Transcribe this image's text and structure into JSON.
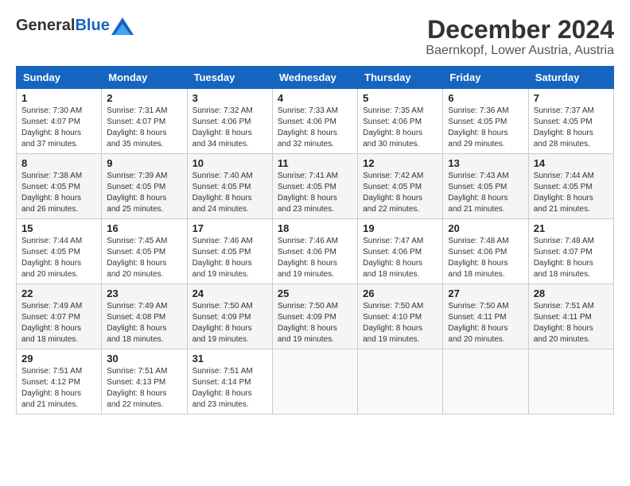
{
  "header": {
    "logo_general": "General",
    "logo_blue": "Blue",
    "title": "December 2024",
    "subtitle": "Baernkopf, Lower Austria, Austria"
  },
  "calendar": {
    "days_of_week": [
      "Sunday",
      "Monday",
      "Tuesday",
      "Wednesday",
      "Thursday",
      "Friday",
      "Saturday"
    ],
    "weeks": [
      [
        {
          "day": "",
          "info": ""
        },
        {
          "day": "2",
          "info": "Sunrise: 7:31 AM\nSunset: 4:07 PM\nDaylight: 8 hours\nand 35 minutes."
        },
        {
          "day": "3",
          "info": "Sunrise: 7:32 AM\nSunset: 4:06 PM\nDaylight: 8 hours\nand 34 minutes."
        },
        {
          "day": "4",
          "info": "Sunrise: 7:33 AM\nSunset: 4:06 PM\nDaylight: 8 hours\nand 32 minutes."
        },
        {
          "day": "5",
          "info": "Sunrise: 7:35 AM\nSunset: 4:06 PM\nDaylight: 8 hours\nand 30 minutes."
        },
        {
          "day": "6",
          "info": "Sunrise: 7:36 AM\nSunset: 4:05 PM\nDaylight: 8 hours\nand 29 minutes."
        },
        {
          "day": "7",
          "info": "Sunrise: 7:37 AM\nSunset: 4:05 PM\nDaylight: 8 hours\nand 28 minutes."
        }
      ],
      [
        {
          "day": "8",
          "info": "Sunrise: 7:38 AM\nSunset: 4:05 PM\nDaylight: 8 hours\nand 26 minutes."
        },
        {
          "day": "9",
          "info": "Sunrise: 7:39 AM\nSunset: 4:05 PM\nDaylight: 8 hours\nand 25 minutes."
        },
        {
          "day": "10",
          "info": "Sunrise: 7:40 AM\nSunset: 4:05 PM\nDaylight: 8 hours\nand 24 minutes."
        },
        {
          "day": "11",
          "info": "Sunrise: 7:41 AM\nSunset: 4:05 PM\nDaylight: 8 hours\nand 23 minutes."
        },
        {
          "day": "12",
          "info": "Sunrise: 7:42 AM\nSunset: 4:05 PM\nDaylight: 8 hours\nand 22 minutes."
        },
        {
          "day": "13",
          "info": "Sunrise: 7:43 AM\nSunset: 4:05 PM\nDaylight: 8 hours\nand 21 minutes."
        },
        {
          "day": "14",
          "info": "Sunrise: 7:44 AM\nSunset: 4:05 PM\nDaylight: 8 hours\nand 21 minutes."
        }
      ],
      [
        {
          "day": "15",
          "info": "Sunrise: 7:44 AM\nSunset: 4:05 PM\nDaylight: 8 hours\nand 20 minutes."
        },
        {
          "day": "16",
          "info": "Sunrise: 7:45 AM\nSunset: 4:05 PM\nDaylight: 8 hours\nand 20 minutes."
        },
        {
          "day": "17",
          "info": "Sunrise: 7:46 AM\nSunset: 4:05 PM\nDaylight: 8 hours\nand 19 minutes."
        },
        {
          "day": "18",
          "info": "Sunrise: 7:46 AM\nSunset: 4:06 PM\nDaylight: 8 hours\nand 19 minutes."
        },
        {
          "day": "19",
          "info": "Sunrise: 7:47 AM\nSunset: 4:06 PM\nDaylight: 8 hours\nand 18 minutes."
        },
        {
          "day": "20",
          "info": "Sunrise: 7:48 AM\nSunset: 4:06 PM\nDaylight: 8 hours\nand 18 minutes."
        },
        {
          "day": "21",
          "info": "Sunrise: 7:48 AM\nSunset: 4:07 PM\nDaylight: 8 hours\nand 18 minutes."
        }
      ],
      [
        {
          "day": "22",
          "info": "Sunrise: 7:49 AM\nSunset: 4:07 PM\nDaylight: 8 hours\nand 18 minutes."
        },
        {
          "day": "23",
          "info": "Sunrise: 7:49 AM\nSunset: 4:08 PM\nDaylight: 8 hours\nand 18 minutes."
        },
        {
          "day": "24",
          "info": "Sunrise: 7:50 AM\nSunset: 4:09 PM\nDaylight: 8 hours\nand 19 minutes."
        },
        {
          "day": "25",
          "info": "Sunrise: 7:50 AM\nSunset: 4:09 PM\nDaylight: 8 hours\nand 19 minutes."
        },
        {
          "day": "26",
          "info": "Sunrise: 7:50 AM\nSunset: 4:10 PM\nDaylight: 8 hours\nand 19 minutes."
        },
        {
          "day": "27",
          "info": "Sunrise: 7:50 AM\nSunset: 4:11 PM\nDaylight: 8 hours\nand 20 minutes."
        },
        {
          "day": "28",
          "info": "Sunrise: 7:51 AM\nSunset: 4:11 PM\nDaylight: 8 hours\nand 20 minutes."
        }
      ],
      [
        {
          "day": "29",
          "info": "Sunrise: 7:51 AM\nSunset: 4:12 PM\nDaylight: 8 hours\nand 21 minutes."
        },
        {
          "day": "30",
          "info": "Sunrise: 7:51 AM\nSunset: 4:13 PM\nDaylight: 8 hours\nand 22 minutes."
        },
        {
          "day": "31",
          "info": "Sunrise: 7:51 AM\nSunset: 4:14 PM\nDaylight: 8 hours\nand 23 minutes."
        },
        {
          "day": "",
          "info": ""
        },
        {
          "day": "",
          "info": ""
        },
        {
          "day": "",
          "info": ""
        },
        {
          "day": "",
          "info": ""
        }
      ]
    ],
    "week0_day1": {
      "day": "1",
      "info": "Sunrise: 7:30 AM\nSunset: 4:07 PM\nDaylight: 8 hours\nand 37 minutes."
    }
  }
}
